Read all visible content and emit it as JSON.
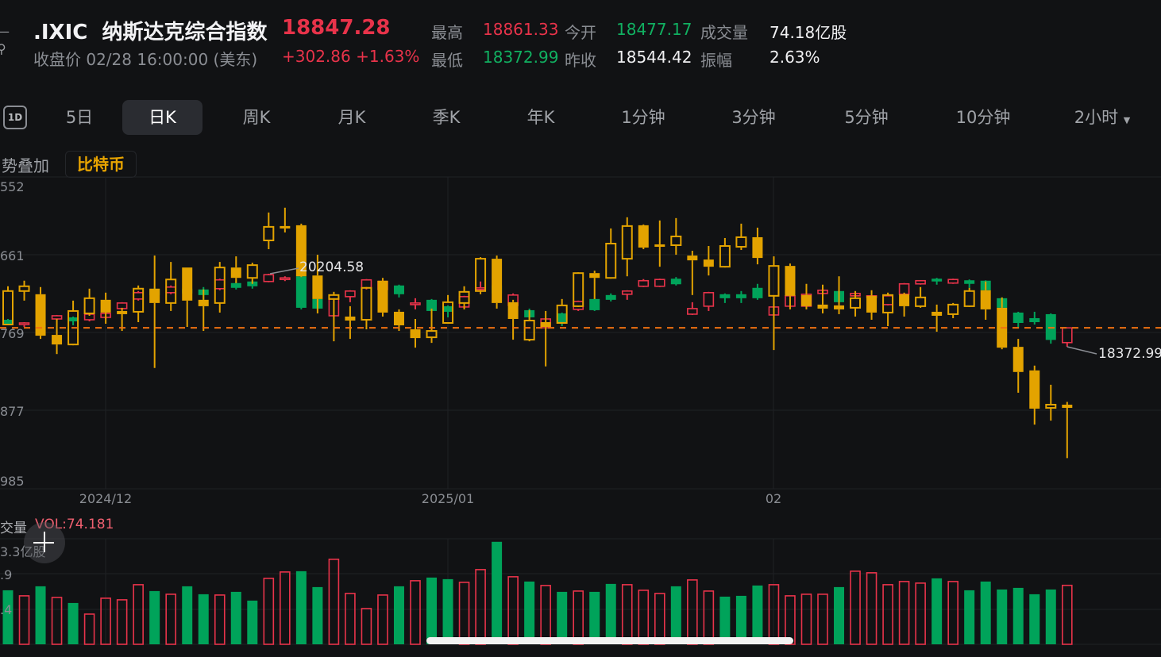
{
  "header": {
    "symbol": ".IXIC",
    "name": "纳斯达克综合指数",
    "last_price": "18847.28",
    "close_info": "收盘价 02/28 16:00:00 (美东)",
    "change": "+302.86",
    "change_pct": "+1.63%",
    "stats": {
      "high_label": "最高",
      "high": "18861.33",
      "low_label": "最低",
      "low": "18372.99",
      "open_label": "今开",
      "open": "18477.17",
      "prev_close_label": "昨收",
      "prev_close": "18544.42",
      "volume_label": "成交量",
      "volume": "74.18亿股",
      "amplitude_label": "振幅",
      "amplitude": "2.63%"
    }
  },
  "tabs": {
    "icon_1d": "1D",
    "items": [
      "5日",
      "日K",
      "周K",
      "月K",
      "季K",
      "年K",
      "1分钟",
      "3分钟",
      "5分钟",
      "10分钟",
      "2小时"
    ],
    "selected": "日K"
  },
  "overlay": {
    "label": "势叠加",
    "chip": "比特币"
  },
  "volume_panel": {
    "title": "交量",
    "value": "VOL:74.181",
    "axis_labels": [
      "3.3亿股",
      ".9",
      ".4"
    ]
  },
  "colors": {
    "up": "#e8334a",
    "down": "#00a35a",
    "overlay": "#e3a300",
    "last_price_line": "#f07010",
    "bg": "#111214"
  },
  "chart_data": {
    "type": "candlestick",
    "y_axis_labels": [
      "552",
      "661",
      "769",
      "877",
      "985"
    ],
    "x_axis_labels": [
      "2024/12",
      "2025/01",
      "02"
    ],
    "x_axis_label_index": [
      6,
      27,
      47
    ],
    "max_label": "20204.58",
    "min_label": "18372.99",
    "last_price": 18847.28,
    "main_ohlc_fields": [
      "open",
      "high",
      "low",
      "close"
    ],
    "main_candles": [
      [
        19050,
        19070,
        18910,
        18950
      ],
      [
        18930,
        18990,
        18870,
        18970
      ],
      [
        18950,
        18990,
        18830,
        18870
      ],
      [
        19070,
        19170,
        19030,
        19150
      ],
      [
        19110,
        19130,
        18910,
        19010
      ],
      [
        19050,
        19210,
        19010,
        19190
      ],
      [
        19110,
        19250,
        19070,
        19210
      ],
      [
        19330,
        19490,
        19290,
        19470
      ],
      [
        19570,
        19770,
        19530,
        19730
      ],
      [
        19810,
        19850,
        19610,
        19670
      ],
      [
        19730,
        19910,
        19690,
        19870
      ],
      [
        19830,
        19870,
        19650,
        19710
      ],
      [
        19810,
        19870,
        19550,
        19670
      ],
      [
        19830,
        20080,
        19790,
        20050
      ],
      [
        19970,
        20010,
        19810,
        19850
      ],
      [
        20010,
        20040,
        19830,
        19890
      ],
      [
        20010,
        20204.58,
        19990,
        20180
      ],
      [
        20060,
        20140,
        20020,
        20100
      ],
      [
        20140,
        20160,
        19310,
        19350
      ],
      [
        19570,
        19590,
        19290,
        19330
      ],
      [
        19150,
        19590,
        19130,
        19570
      ],
      [
        19630,
        19790,
        19490,
        19770
      ],
      [
        19850,
        20070,
        19810,
        20050
      ],
      [
        19810,
        20040,
        19770,
        20010
      ],
      [
        19910,
        19930,
        19610,
        19690
      ],
      [
        19430,
        19590,
        19310,
        19470
      ],
      [
        19550,
        19570,
        19250,
        19270
      ],
      [
        19390,
        19410,
        19110,
        19250
      ],
      [
        19370,
        19650,
        19350,
        19630
      ],
      [
        19810,
        20010,
        19770,
        19850
      ],
      [
        19910,
        19950,
        19670,
        19710
      ],
      [
        19410,
        19710,
        19370,
        19670
      ],
      [
        19290,
        19330,
        19070,
        19110
      ],
      [
        18850,
        19090,
        18830,
        19070
      ],
      [
        19210,
        19230,
        18890,
        18970
      ],
      [
        19310,
        19530,
        19270,
        19510
      ],
      [
        19570,
        19590,
        19270,
        19290
      ],
      [
        19670,
        19710,
        19510,
        19550
      ],
      [
        19690,
        19790,
        19550,
        19770
      ],
      [
        19890,
        20070,
        19870,
        20030
      ],
      [
        19890,
        20080,
        19870,
        20060
      ],
      [
        20080,
        20120,
        19910,
        19940
      ],
      [
        19190,
        19490,
        19170,
        19330
      ],
      [
        19390,
        19750,
        19270,
        19730
      ],
      [
        19690,
        19710,
        19470,
        19590
      ],
      [
        19690,
        19770,
        19470,
        19590
      ],
      [
        19850,
        19950,
        19550,
        19590
      ],
      [
        19170,
        19390,
        19150,
        19370
      ],
      [
        19390,
        19670,
        19350,
        19650
      ],
      [
        19390,
        19710,
        19350,
        19690
      ],
      [
        19710,
        19830,
        19670,
        19790
      ],
      [
        19770,
        19810,
        19450,
        19490
      ],
      [
        19650,
        19750,
        19630,
        19710
      ],
      [
        19610,
        19670,
        19590,
        19650
      ],
      [
        19430,
        19670,
        19410,
        19650
      ],
      [
        19690,
        19970,
        19670,
        19950
      ],
      [
        19950,
        20040,
        19930,
        20030
      ],
      [
        20080,
        20100,
        19930,
        20010
      ],
      [
        19970,
        20080,
        19950,
        20060
      ],
      [
        20040,
        20060,
        19850,
        19950
      ],
      [
        20030,
        20040,
        19770,
        19790
      ],
      [
        19590,
        19610,
        19330,
        19350
      ],
      [
        19230,
        19250,
        18830,
        18970
      ],
      [
        19090,
        19250,
        18930,
        18990
      ],
      [
        19190,
        19210,
        18450,
        18544.42
      ],
      [
        18477.17,
        18861.33,
        18372.99,
        18847.28
      ]
    ],
    "overlay_candles_scaled_to_main_axis": [
      [
        18930,
        19890,
        18910,
        19770
      ],
      [
        19770,
        20030,
        19530,
        19890
      ],
      [
        19690,
        19870,
        18570,
        18650
      ],
      [
        18670,
        19070,
        18190,
        18430
      ],
      [
        18430,
        19530,
        18410,
        19270
      ],
      [
        19210,
        19830,
        19150,
        19590
      ],
      [
        19550,
        19730,
        18950,
        19230
      ],
      [
        19270,
        19350,
        18770,
        19190
      ],
      [
        19250,
        19910,
        18990,
        19830
      ],
      [
        19830,
        20660,
        17840,
        19470
      ],
      [
        19470,
        20500,
        19270,
        20060
      ],
      [
        20360,
        20360,
        18870,
        19530
      ],
      [
        19550,
        19810,
        18770,
        19390
      ],
      [
        19470,
        20500,
        19230,
        20360
      ],
      [
        20360,
        20640,
        19970,
        20100
      ],
      [
        20100,
        20480,
        19950,
        20420
      ],
      [
        21040,
        21740,
        20820,
        21380
      ],
      [
        21400,
        21860,
        21240,
        21340
      ],
      [
        21420,
        21460,
        20120,
        20140
      ],
      [
        20160,
        20680,
        19210,
        19570
      ],
      [
        19570,
        19750,
        18510,
        19670
      ],
      [
        19130,
        19390,
        18570,
        19030
      ],
      [
        19050,
        19870,
        18810,
        19850
      ],
      [
        20030,
        20100,
        19130,
        19230
      ],
      [
        19250,
        19310,
        18770,
        18910
      ],
      [
        18810,
        19070,
        18350,
        18590
      ],
      [
        18610,
        19330,
        18470,
        18770
      ],
      [
        18970,
        19670,
        18950,
        19490
      ],
      [
        19470,
        19890,
        19310,
        19750
      ],
      [
        19770,
        20620,
        19690,
        20580
      ],
      [
        20580,
        20660,
        19330,
        19470
      ],
      [
        19490,
        19550,
        18550,
        19070
      ],
      [
        18550,
        19290,
        18510,
        19030
      ],
      [
        18990,
        19270,
        17880,
        18870
      ],
      [
        18970,
        19570,
        18950,
        19410
      ],
      [
        19390,
        20240,
        19370,
        20220
      ],
      [
        20220,
        20280,
        19570,
        20100
      ],
      [
        20100,
        21340,
        20080,
        20960
      ],
      [
        20580,
        21620,
        20140,
        21400
      ],
      [
        21420,
        21440,
        20820,
        20860
      ],
      [
        20940,
        21540,
        20380,
        20880
      ],
      [
        20920,
        21600,
        20680,
        21140
      ],
      [
        20660,
        20780,
        19670,
        20540
      ],
      [
        20560,
        20900,
        20160,
        20380
      ],
      [
        20380,
        21100,
        20360,
        20900
      ],
      [
        20880,
        21460,
        20800,
        21120
      ],
      [
        21120,
        21360,
        20440,
        20600
      ],
      [
        19650,
        20640,
        18290,
        20400
      ],
      [
        20400,
        20460,
        19310,
        19650
      ],
      [
        19670,
        19950,
        19310,
        19390
      ],
      [
        19430,
        19930,
        19210,
        19330
      ],
      [
        19410,
        20140,
        19190,
        19310
      ],
      [
        19350,
        19770,
        19130,
        19590
      ],
      [
        19650,
        19790,
        19050,
        19230
      ],
      [
        19230,
        19730,
        18890,
        19670
      ],
      [
        19690,
        19730,
        19130,
        19390
      ],
      [
        19390,
        19870,
        19350,
        19610
      ],
      [
        19250,
        19430,
        18750,
        19150
      ],
      [
        19190,
        19470,
        19090,
        19430
      ],
      [
        19390,
        19850,
        19370,
        19770
      ],
      [
        19790,
        20010,
        19050,
        19310
      ],
      [
        19350,
        19610,
        18310,
        18350
      ],
      [
        18370,
        18570,
        17220,
        17740
      ],
      [
        17780,
        17900,
        16420,
        16820
      ],
      [
        16840,
        17420,
        16520,
        16920
      ],
      [
        16920,
        16990,
        15580,
        16840
      ]
    ],
    "volume_unit": "亿股",
    "volume_max_axis": 133.3,
    "volumes": [
      68,
      61,
      73,
      59,
      52,
      38,
      58,
      56,
      75,
      67,
      63,
      73,
      63,
      62,
      66,
      55,
      83,
      91,
      92,
      72,
      107,
      64,
      45,
      62,
      73,
      80,
      84,
      82,
      78,
      94,
      129,
      85,
      79,
      74,
      66,
      67,
      66,
      76,
      75,
      68,
      64,
      73,
      81,
      67,
      60,
      61,
      74,
      75,
      61,
      63,
      63,
      72,
      92,
      90,
      75,
      79,
      77,
      83,
      79,
      68,
      79,
      69,
      71,
      63,
      69,
      74.181
    ]
  }
}
